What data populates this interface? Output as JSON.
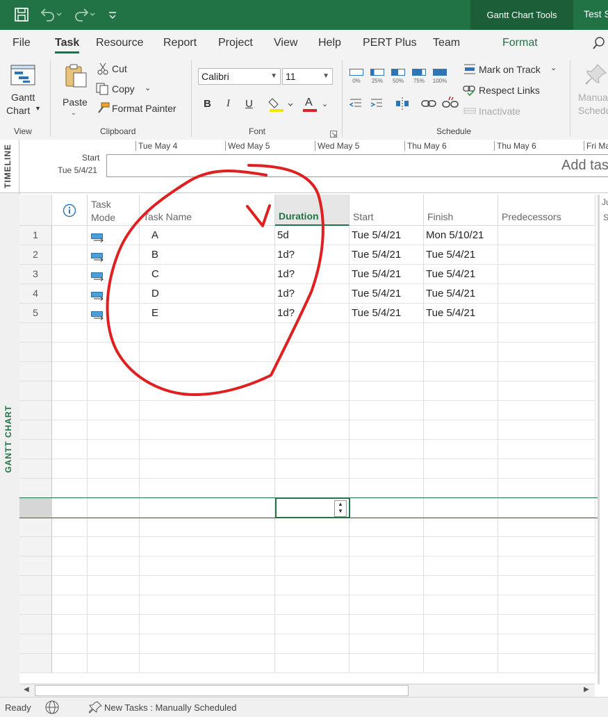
{
  "titlebar": {
    "context_tab": "Gantt Chart Tools",
    "account": "Test S"
  },
  "tabs": [
    "File",
    "Task",
    "Resource",
    "Report",
    "Project",
    "View",
    "Help",
    "PERT Plus",
    "Team",
    "Format"
  ],
  "ribbon": {
    "view_group": {
      "gantt_label_1": "Gantt",
      "gantt_label_2": "Chart",
      "group_label": "View"
    },
    "clipboard": {
      "paste": "Paste",
      "cut": "Cut",
      "copy": "Copy",
      "format_painter": "Format Painter",
      "group_label": "Clipboard"
    },
    "font": {
      "family": "Calibri",
      "size": "11",
      "bold": "B",
      "italic": "I",
      "underline": "U",
      "color_letter": "A",
      "group_label": "Font"
    },
    "schedule": {
      "pct": [
        "0%",
        "25%",
        "50%",
        "75%",
        "100%"
      ],
      "mark_on_track": "Mark on Track",
      "respect_links": "Respect Links",
      "inactivate": "Inactivate",
      "group_label": "Schedule"
    },
    "tasks": {
      "manual_1": "Manua",
      "manual_2": "Schedu"
    }
  },
  "timeline": {
    "vertical_label": "TIMELINE",
    "start_label": "Start",
    "start_date": "Tue 5/4/21",
    "ticks": [
      "Tue May 4",
      "Wed May 5",
      "Wed May 5",
      "Thu May 6",
      "Thu May 6",
      "Fri Ma"
    ],
    "add_tasks": "Add tas"
  },
  "gantt": {
    "vertical_label": "GANTT CHART",
    "columns": {
      "info": "i",
      "task_mode_1": "Task",
      "task_mode_2": "Mode",
      "task_name": "Task Name",
      "duration": "Duration",
      "start": "Start",
      "finish": "Finish",
      "predecessors": "Predecessors",
      "right_1": "Ju",
      "right_2": "S"
    },
    "rows": [
      {
        "id": "1",
        "name": "A",
        "duration": "5d",
        "start": "Tue 5/4/21",
        "finish": "Mon 5/10/21"
      },
      {
        "id": "2",
        "name": "B",
        "duration": "1d?",
        "start": "Tue 5/4/21",
        "finish": "Tue 5/4/21"
      },
      {
        "id": "3",
        "name": "C",
        "duration": "1d?",
        "start": "Tue 5/4/21",
        "finish": "Tue 5/4/21"
      },
      {
        "id": "4",
        "name": "D",
        "duration": "1d?",
        "start": "Tue 5/4/21",
        "finish": "Tue 5/4/21"
      },
      {
        "id": "5",
        "name": "E",
        "duration": "1d?",
        "start": "Tue 5/4/21",
        "finish": "Tue 5/4/21"
      }
    ]
  },
  "status": {
    "ready": "Ready",
    "new_tasks": "New Tasks : Manually Scheduled"
  },
  "colors": {
    "brand": "#217346",
    "annotation": "#e02020",
    "mode_icon": "#4a9fd8"
  }
}
